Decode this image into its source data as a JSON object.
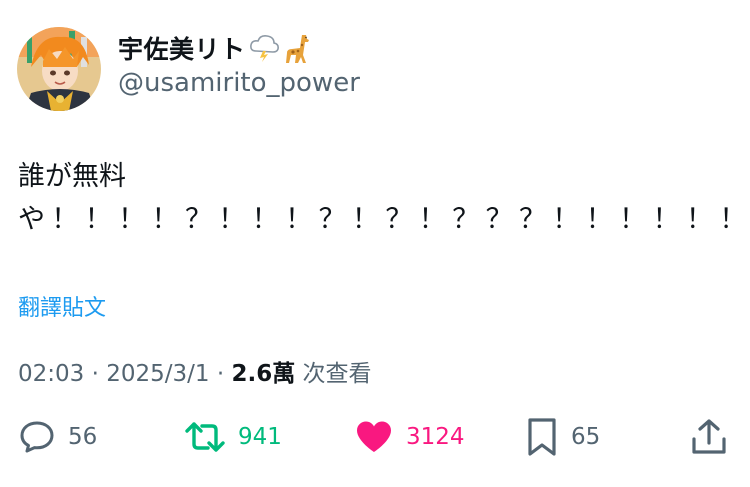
{
  "user": {
    "display_name": "宇佐美リト",
    "emojis": [
      "cloud-lightning-icon",
      "giraffe-icon"
    ],
    "handle": "@usamirito_power"
  },
  "tweet": {
    "line1": "誰が無料",
    "line2": "や！！！！？！！！？！？！？？？！！！！！！"
  },
  "translate": {
    "label": "翻譯貼文"
  },
  "meta": {
    "time": "02:03",
    "sep1": " · ",
    "date": "2025/3/1",
    "sep2": " · ",
    "views": "2.6萬",
    "views_suffix": " 次查看"
  },
  "actions": {
    "reply_count": "56",
    "retweet_count": "941",
    "like_count": "3124",
    "bookmark_count": "65"
  },
  "colors": {
    "text": "#0f1419",
    "secondary": "#536471",
    "link": "#1d9bf0",
    "retweet": "#00ba7c",
    "like": "#f91880"
  }
}
